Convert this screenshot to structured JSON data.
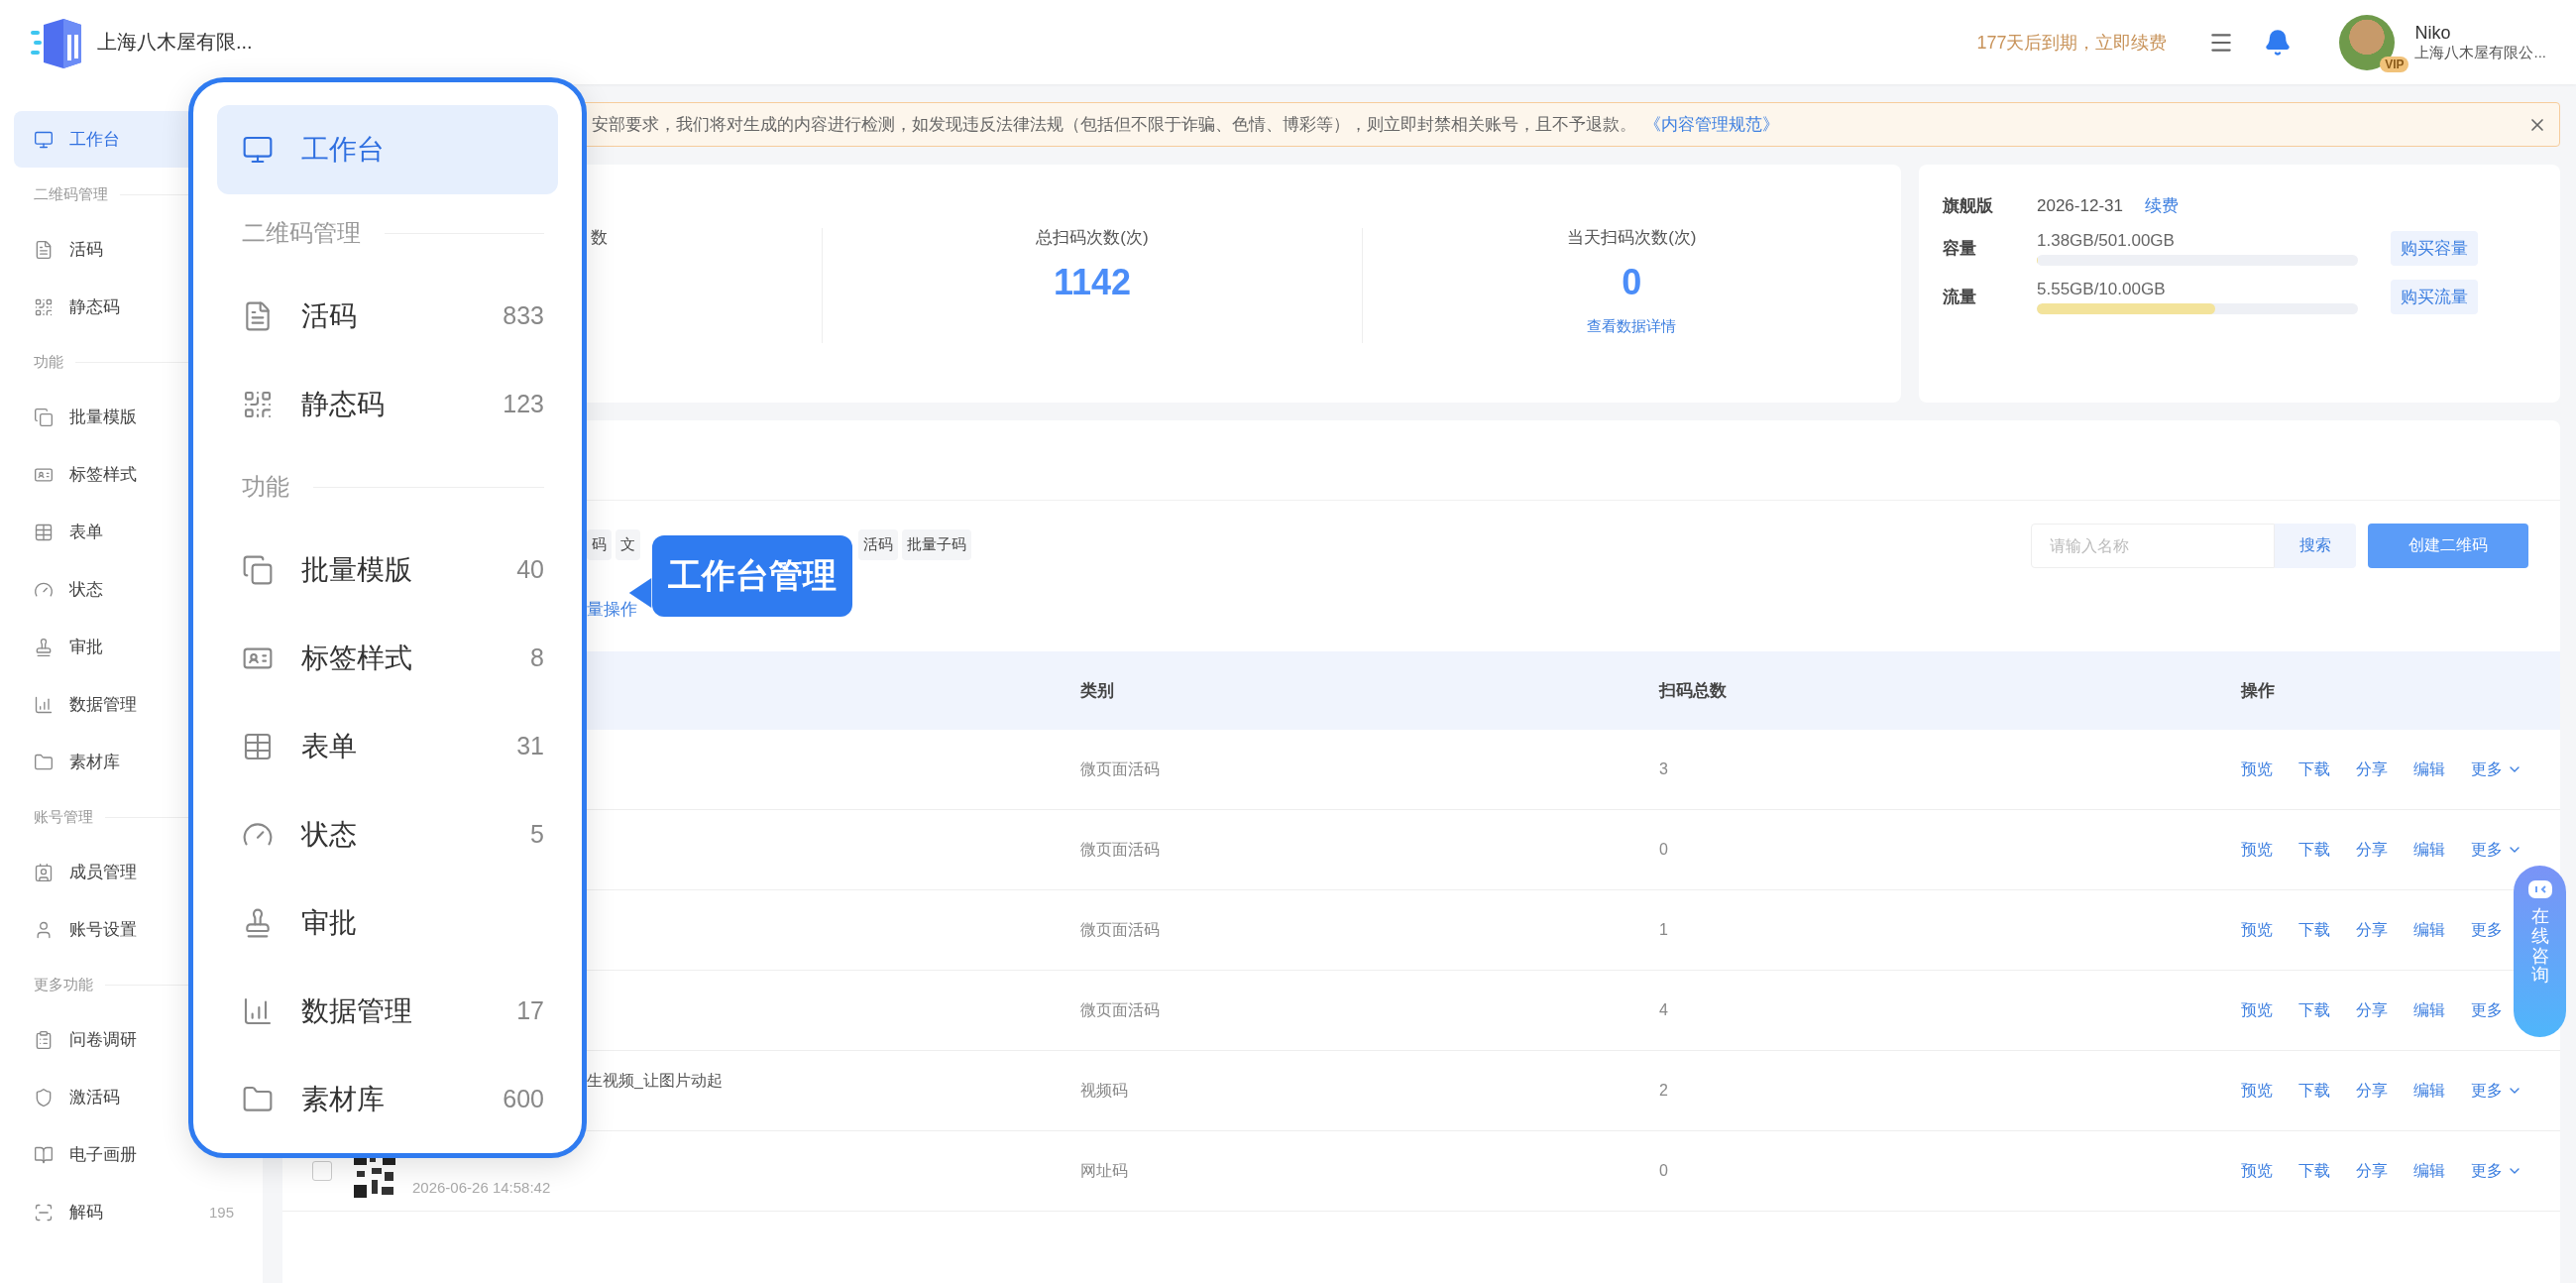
{
  "header": {
    "company": "上海八木屋有限...",
    "expiry": "177天后到期，立即续费",
    "user": {
      "name": "Niko",
      "badge": "VIP",
      "org": "上海八木屋有限公..."
    }
  },
  "sidebar": {
    "items": [
      {
        "label": "工作台",
        "selected": true
      }
    ],
    "sections": [
      {
        "title": "二维码管理",
        "items": [
          {
            "label": "活码",
            "selected": false
          },
          {
            "label": "静态码",
            "selected": false
          }
        ]
      },
      {
        "title": "功能",
        "items": [
          {
            "label": "批量模版",
            "selected": false
          },
          {
            "label": "标签样式",
            "selected": false
          },
          {
            "label": "表单",
            "selected": false
          },
          {
            "label": "状态",
            "selected": false
          },
          {
            "label": "审批",
            "selected": false
          },
          {
            "label": "数据管理",
            "selected": false
          },
          {
            "label": "素材库",
            "selected": false
          }
        ]
      },
      {
        "title": "账号管理",
        "items": [
          {
            "label": "成员管理",
            "selected": false
          },
          {
            "label": "账号设置",
            "selected": false
          }
        ]
      },
      {
        "title": "更多功能",
        "items": [
          {
            "label": "问卷调研",
            "selected": false
          },
          {
            "label": "激活码",
            "selected": false
          },
          {
            "label": "电子画册",
            "selected": false
          },
          {
            "label": "解码",
            "selected": false,
            "count": "195"
          }
        ]
      }
    ]
  },
  "popup": {
    "top": {
      "label": "工作台",
      "selected": true
    },
    "sections": [
      {
        "title": "二维码管理",
        "items": [
          {
            "label": "活码",
            "count": "833",
            "selected": false
          },
          {
            "label": "静态码",
            "count": "123",
            "selected": false
          }
        ]
      },
      {
        "title": "功能",
        "items": [
          {
            "label": "批量模版",
            "count": "40",
            "selected": false
          },
          {
            "label": "标签样式",
            "count": "8",
            "selected": false
          },
          {
            "label": "表单",
            "count": "31",
            "selected": false
          },
          {
            "label": "状态",
            "count": "5",
            "selected": false
          },
          {
            "label": "审批",
            "selected": false
          },
          {
            "label": "数据管理",
            "count": "17",
            "selected": false
          },
          {
            "label": "素材库",
            "count": "600",
            "selected": false
          }
        ]
      }
    ]
  },
  "callout": "工作台管理",
  "notice": {
    "text": "安部要求，我们将对生成的内容进行检测，如发现违反法律法规（包括但不限于诈骗、色情、博彩等），则立即封禁相关账号，且不予退款。",
    "link": "《内容管理规范》"
  },
  "stats": [
    {
      "label": "数"
    },
    {
      "label": "总扫码次数(次)",
      "value": "1142"
    },
    {
      "label": "当天扫码次数(次)",
      "value": "0",
      "link": "查看数据详情"
    }
  ],
  "plan": {
    "edition": "旗舰版",
    "expiry": "2026-12-31",
    "renew": "续费",
    "quotas": [
      {
        "label": "容量",
        "usage": "1.38GB/501.00GB",
        "level": 0.003,
        "button": "购买容量"
      },
      {
        "label": "流量",
        "usage": "5.55GB/10.00GB",
        "level": 0.555,
        "button": "购买流量"
      }
    ]
  },
  "list": {
    "tags": [
      "码",
      "文",
      "活码",
      "批量子码"
    ],
    "batch_link": "量操作",
    "search": {
      "placeholder": "请输入名称",
      "button": "搜索"
    },
    "create_button": "创建二维码",
    "columns": [
      "类别",
      "扫码总数",
      "操作"
    ],
    "rows": [
      {
        "category": "微页面活码",
        "scans": "3",
        "actions": [
          "预览",
          "下载",
          "分享",
          "编辑",
          "更多"
        ],
        "more_arrow": true
      },
      {
        "category": "微页面活码",
        "scans": "0",
        "actions": [
          "预览",
          "下载",
          "分享",
          "编辑",
          "更多"
        ],
        "more_arrow": true
      },
      {
        "category": "微页面活码",
        "scans": "1",
        "actions": [
          "预览",
          "下载",
          "分享",
          "编辑",
          "更多"
        ],
        "more_arrow": false
      },
      {
        "category": "微页面活码",
        "scans": "4",
        "actions": [
          "预览",
          "下载",
          "分享",
          "编辑",
          "更多"
        ],
        "more_arrow": false
      },
      {
        "name": "生视频_让图片动起",
        "category": "视频码",
        "scans": "2",
        "actions": [
          "预览",
          "下载",
          "分享",
          "编辑",
          "更多"
        ],
        "more_arrow": true
      },
      {
        "checked": false,
        "thumbnail": {
          "kind": "qr"
        },
        "date": "2026-06-26 14:58:42",
        "category": "网址码",
        "scans": "0",
        "actions": [
          "预览",
          "下载",
          "分享",
          "编辑",
          "更多"
        ],
        "more_arrow": true
      }
    ]
  },
  "consult": "在线咨询"
}
